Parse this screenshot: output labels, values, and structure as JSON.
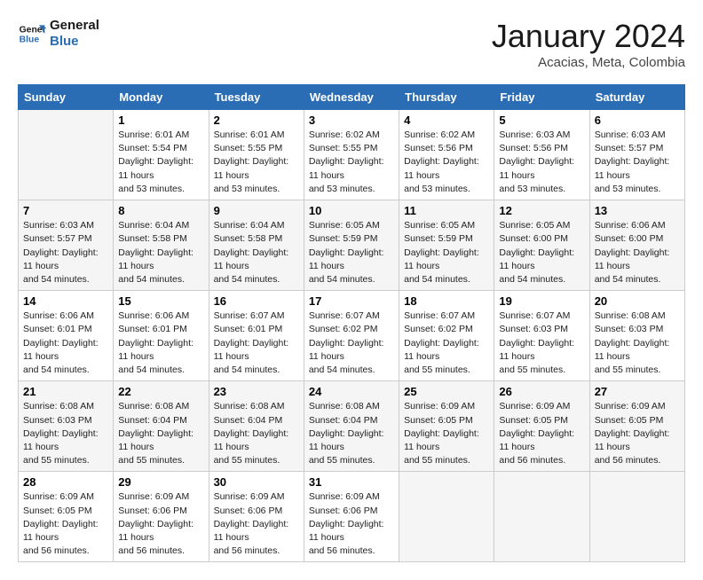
{
  "header": {
    "logo_line1": "General",
    "logo_line2": "Blue",
    "month": "January 2024",
    "location": "Acacias, Meta, Colombia"
  },
  "days_of_week": [
    "Sunday",
    "Monday",
    "Tuesday",
    "Wednesday",
    "Thursday",
    "Friday",
    "Saturday"
  ],
  "weeks": [
    [
      {
        "day": "",
        "sunrise": "",
        "sunset": "",
        "daylight": ""
      },
      {
        "day": "1",
        "sunrise": "Sunrise: 6:01 AM",
        "sunset": "Sunset: 5:54 PM",
        "daylight": "Daylight: 11 hours and 53 minutes."
      },
      {
        "day": "2",
        "sunrise": "Sunrise: 6:01 AM",
        "sunset": "Sunset: 5:55 PM",
        "daylight": "Daylight: 11 hours and 53 minutes."
      },
      {
        "day": "3",
        "sunrise": "Sunrise: 6:02 AM",
        "sunset": "Sunset: 5:55 PM",
        "daylight": "Daylight: 11 hours and 53 minutes."
      },
      {
        "day": "4",
        "sunrise": "Sunrise: 6:02 AM",
        "sunset": "Sunset: 5:56 PM",
        "daylight": "Daylight: 11 hours and 53 minutes."
      },
      {
        "day": "5",
        "sunrise": "Sunrise: 6:03 AM",
        "sunset": "Sunset: 5:56 PM",
        "daylight": "Daylight: 11 hours and 53 minutes."
      },
      {
        "day": "6",
        "sunrise": "Sunrise: 6:03 AM",
        "sunset": "Sunset: 5:57 PM",
        "daylight": "Daylight: 11 hours and 53 minutes."
      }
    ],
    [
      {
        "day": "7",
        "sunrise": "Sunrise: 6:03 AM",
        "sunset": "Sunset: 5:57 PM",
        "daylight": "Daylight: 11 hours and 54 minutes."
      },
      {
        "day": "8",
        "sunrise": "Sunrise: 6:04 AM",
        "sunset": "Sunset: 5:58 PM",
        "daylight": "Daylight: 11 hours and 54 minutes."
      },
      {
        "day": "9",
        "sunrise": "Sunrise: 6:04 AM",
        "sunset": "Sunset: 5:58 PM",
        "daylight": "Daylight: 11 hours and 54 minutes."
      },
      {
        "day": "10",
        "sunrise": "Sunrise: 6:05 AM",
        "sunset": "Sunset: 5:59 PM",
        "daylight": "Daylight: 11 hours and 54 minutes."
      },
      {
        "day": "11",
        "sunrise": "Sunrise: 6:05 AM",
        "sunset": "Sunset: 5:59 PM",
        "daylight": "Daylight: 11 hours and 54 minutes."
      },
      {
        "day": "12",
        "sunrise": "Sunrise: 6:05 AM",
        "sunset": "Sunset: 6:00 PM",
        "daylight": "Daylight: 11 hours and 54 minutes."
      },
      {
        "day": "13",
        "sunrise": "Sunrise: 6:06 AM",
        "sunset": "Sunset: 6:00 PM",
        "daylight": "Daylight: 11 hours and 54 minutes."
      }
    ],
    [
      {
        "day": "14",
        "sunrise": "Sunrise: 6:06 AM",
        "sunset": "Sunset: 6:01 PM",
        "daylight": "Daylight: 11 hours and 54 minutes."
      },
      {
        "day": "15",
        "sunrise": "Sunrise: 6:06 AM",
        "sunset": "Sunset: 6:01 PM",
        "daylight": "Daylight: 11 hours and 54 minutes."
      },
      {
        "day": "16",
        "sunrise": "Sunrise: 6:07 AM",
        "sunset": "Sunset: 6:01 PM",
        "daylight": "Daylight: 11 hours and 54 minutes."
      },
      {
        "day": "17",
        "sunrise": "Sunrise: 6:07 AM",
        "sunset": "Sunset: 6:02 PM",
        "daylight": "Daylight: 11 hours and 54 minutes."
      },
      {
        "day": "18",
        "sunrise": "Sunrise: 6:07 AM",
        "sunset": "Sunset: 6:02 PM",
        "daylight": "Daylight: 11 hours and 55 minutes."
      },
      {
        "day": "19",
        "sunrise": "Sunrise: 6:07 AM",
        "sunset": "Sunset: 6:03 PM",
        "daylight": "Daylight: 11 hours and 55 minutes."
      },
      {
        "day": "20",
        "sunrise": "Sunrise: 6:08 AM",
        "sunset": "Sunset: 6:03 PM",
        "daylight": "Daylight: 11 hours and 55 minutes."
      }
    ],
    [
      {
        "day": "21",
        "sunrise": "Sunrise: 6:08 AM",
        "sunset": "Sunset: 6:03 PM",
        "daylight": "Daylight: 11 hours and 55 minutes."
      },
      {
        "day": "22",
        "sunrise": "Sunrise: 6:08 AM",
        "sunset": "Sunset: 6:04 PM",
        "daylight": "Daylight: 11 hours and 55 minutes."
      },
      {
        "day": "23",
        "sunrise": "Sunrise: 6:08 AM",
        "sunset": "Sunset: 6:04 PM",
        "daylight": "Daylight: 11 hours and 55 minutes."
      },
      {
        "day": "24",
        "sunrise": "Sunrise: 6:08 AM",
        "sunset": "Sunset: 6:04 PM",
        "daylight": "Daylight: 11 hours and 55 minutes."
      },
      {
        "day": "25",
        "sunrise": "Sunrise: 6:09 AM",
        "sunset": "Sunset: 6:05 PM",
        "daylight": "Daylight: 11 hours and 55 minutes."
      },
      {
        "day": "26",
        "sunrise": "Sunrise: 6:09 AM",
        "sunset": "Sunset: 6:05 PM",
        "daylight": "Daylight: 11 hours and 56 minutes."
      },
      {
        "day": "27",
        "sunrise": "Sunrise: 6:09 AM",
        "sunset": "Sunset: 6:05 PM",
        "daylight": "Daylight: 11 hours and 56 minutes."
      }
    ],
    [
      {
        "day": "28",
        "sunrise": "Sunrise: 6:09 AM",
        "sunset": "Sunset: 6:05 PM",
        "daylight": "Daylight: 11 hours and 56 minutes."
      },
      {
        "day": "29",
        "sunrise": "Sunrise: 6:09 AM",
        "sunset": "Sunset: 6:06 PM",
        "daylight": "Daylight: 11 hours and 56 minutes."
      },
      {
        "day": "30",
        "sunrise": "Sunrise: 6:09 AM",
        "sunset": "Sunset: 6:06 PM",
        "daylight": "Daylight: 11 hours and 56 minutes."
      },
      {
        "day": "31",
        "sunrise": "Sunrise: 6:09 AM",
        "sunset": "Sunset: 6:06 PM",
        "daylight": "Daylight: 11 hours and 56 minutes."
      },
      {
        "day": "",
        "sunrise": "",
        "sunset": "",
        "daylight": ""
      },
      {
        "day": "",
        "sunrise": "",
        "sunset": "",
        "daylight": ""
      },
      {
        "day": "",
        "sunrise": "",
        "sunset": "",
        "daylight": ""
      }
    ]
  ]
}
